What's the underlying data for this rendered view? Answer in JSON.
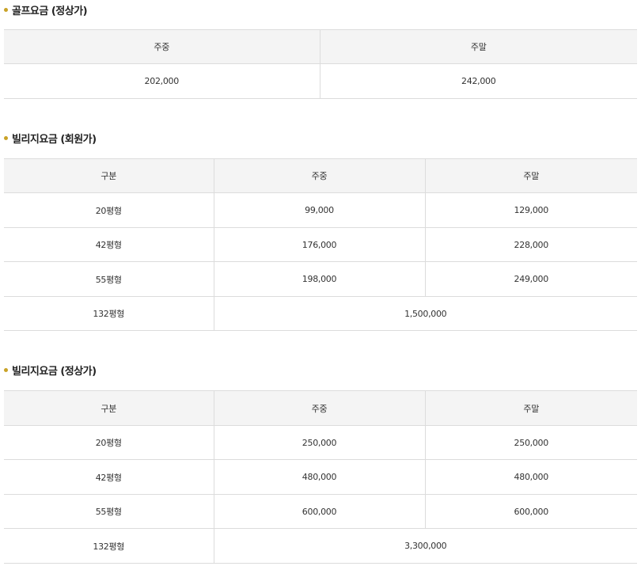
{
  "golf_regular": {
    "title": "골프요금 (정상가)",
    "headers": [
      "주중",
      "주말"
    ],
    "values": [
      "202,000",
      "242,000"
    ]
  },
  "villa_member": {
    "title": "빌리지요금 (회원가)",
    "headers": [
      "구분",
      "주중",
      "주말"
    ],
    "rows": [
      [
        "20평형",
        "99,000",
        "129,000"
      ],
      [
        "42평형",
        "176,000",
        "228,000"
      ],
      [
        "55평형",
        "198,000",
        "249,000"
      ]
    ],
    "merged_row": [
      "132평형",
      "1,500,000"
    ]
  },
  "villa_regular": {
    "title": "빌리지요금 (정상가)",
    "headers": [
      "구분",
      "주중",
      "주말"
    ],
    "rows": [
      [
        "20평형",
        "250,000",
        "250,000"
      ],
      [
        "42평형",
        "480,000",
        "480,000"
      ],
      [
        "55평형",
        "600,000",
        "600,000"
      ]
    ],
    "merged_row": [
      "132평형",
      "3,300,000"
    ]
  },
  "colors": {
    "bullet": "#c9a227",
    "header_bg": "#f4f4f4",
    "border": "#dcdcdc",
    "text": "#333333"
  }
}
